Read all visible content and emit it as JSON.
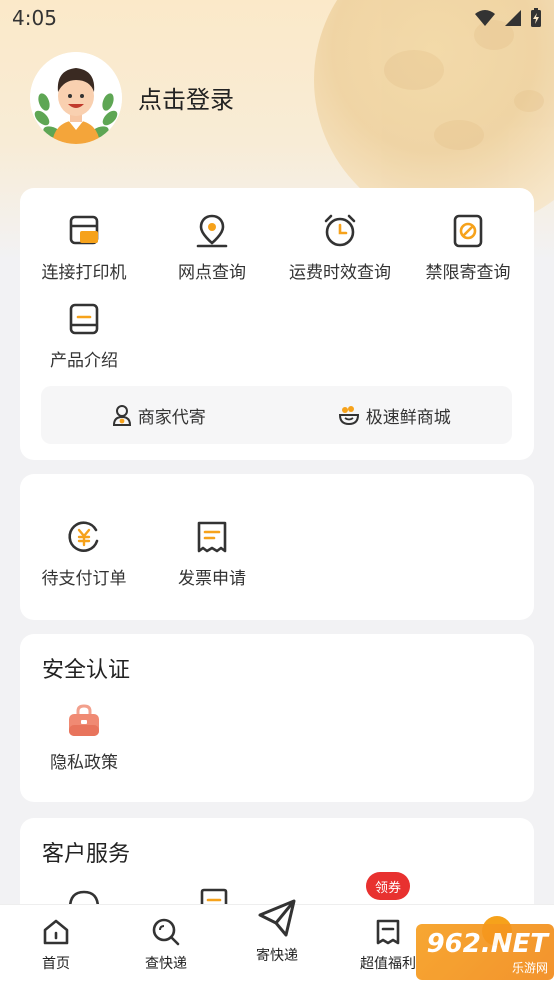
{
  "status_bar": {
    "time": "4:05"
  },
  "profile": {
    "login_text": "点击登录"
  },
  "tools": {
    "items": [
      {
        "label": "连接打印机",
        "icon": "printer-icon"
      },
      {
        "label": "网点查询",
        "icon": "location-pin-icon"
      },
      {
        "label": "运费时效查询",
        "icon": "alarm-clock-icon"
      },
      {
        "label": "禁限寄查询",
        "icon": "prohibited-icon"
      },
      {
        "label": "产品介绍",
        "icon": "book-icon"
      }
    ],
    "merchant": "商家代寄",
    "fresh_mall": "极速鲜商城"
  },
  "orders": {
    "items": [
      {
        "label": "待支付订单",
        "icon": "yuan-payment-icon"
      },
      {
        "label": "发票申请",
        "icon": "invoice-icon"
      }
    ]
  },
  "security": {
    "title": "安全认证",
    "privacy": "隐私政策"
  },
  "service": {
    "title": "客户服务"
  },
  "bottom_nav": {
    "home": "首页",
    "track": "查快递",
    "send": "寄快递",
    "deals": "超值福利",
    "coupon_badge": "领券"
  },
  "watermark": {
    "brand": "962.NET",
    "sub": "乐游网"
  },
  "colors": {
    "accent": "#f6a21b",
    "badge_red": "#e8312f",
    "privacy_icon": "#f08a73"
  }
}
